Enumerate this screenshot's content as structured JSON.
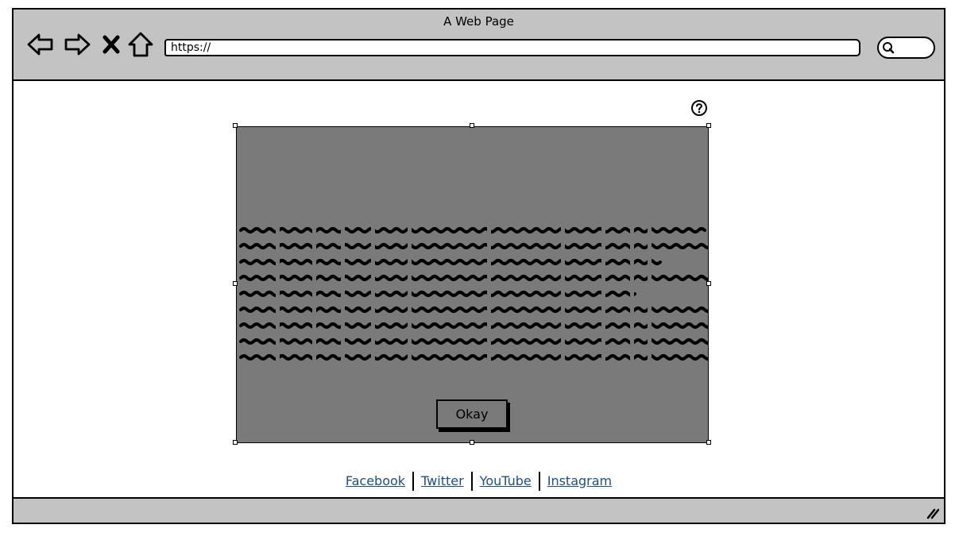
{
  "window": {
    "title": "A Web Page"
  },
  "toolbar": {
    "back_icon": "back-arrow",
    "forward_icon": "forward-arrow",
    "stop_icon": "close-x",
    "home_icon": "home"
  },
  "address_bar": {
    "value": "https://"
  },
  "search": {
    "icon": "magnifier"
  },
  "help": {
    "icon": "question-mark"
  },
  "modal": {
    "body_text": "scribbled placeholder text",
    "okay_label": "Okay",
    "background": "#7a7a7a"
  },
  "footer": {
    "links": [
      "Facebook",
      "Twitter",
      "YouTube",
      "Instagram"
    ],
    "link_color": "#1a4f8a"
  }
}
